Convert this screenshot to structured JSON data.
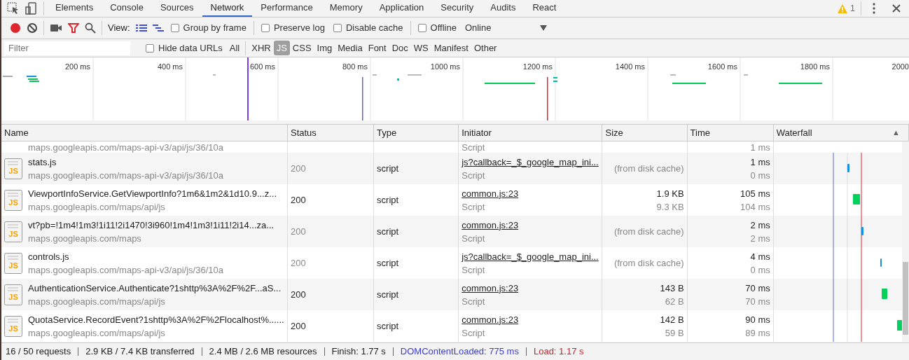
{
  "tabs": [
    {
      "label": "Elements",
      "selected": false
    },
    {
      "label": "Console",
      "selected": false
    },
    {
      "label": "Sources",
      "selected": false
    },
    {
      "label": "Network",
      "selected": true
    },
    {
      "label": "Performance",
      "selected": false
    },
    {
      "label": "Memory",
      "selected": false
    },
    {
      "label": "Application",
      "selected": false
    },
    {
      "label": "Security",
      "selected": false
    },
    {
      "label": "Audits",
      "selected": false
    },
    {
      "label": "React",
      "selected": false
    }
  ],
  "warnings": {
    "count": "1"
  },
  "toolbar": {
    "recording": true,
    "filter_active": true,
    "view_label": "View:",
    "checkboxes": [
      {
        "label": "Group by frame",
        "checked": false
      },
      {
        "label": "Preserve log",
        "checked": false
      },
      {
        "label": "Disable cache",
        "checked": false
      },
      {
        "label": "Offline",
        "checked": false
      }
    ],
    "throttling": "Online"
  },
  "filter_bar": {
    "placeholder": "Filter",
    "hide_data_urls": {
      "label": "Hide data URLs",
      "checked": false
    },
    "types": [
      {
        "label": "All",
        "selected": false
      },
      {
        "label": "XHR",
        "selected": false
      },
      {
        "label": "JS",
        "selected": true
      },
      {
        "label": "CSS",
        "selected": false
      },
      {
        "label": "Img",
        "selected": false
      },
      {
        "label": "Media",
        "selected": false
      },
      {
        "label": "Font",
        "selected": false
      },
      {
        "label": "Doc",
        "selected": false
      },
      {
        "label": "WS",
        "selected": false
      },
      {
        "label": "Manifest",
        "selected": false
      },
      {
        "label": "Other",
        "selected": false
      }
    ]
  },
  "overview": {
    "ticks": [
      "200 ms",
      "400 ms",
      "600 ms",
      "800 ms",
      "1000 ms",
      "1200 ms",
      "1400 ms",
      "1600 ms",
      "1800 ms",
      "2000"
    ]
  },
  "table": {
    "columns": [
      "Name",
      "Status",
      "Type",
      "Initiator",
      "Size",
      "Time",
      "Waterfall"
    ],
    "sort_indicator": "▲",
    "partial_row": {
      "url": "maps.googleapis.com/maps-api-v3/api/js/36/10a",
      "initiator_type": "Script",
      "latency": "1 ms"
    },
    "rows": [
      {
        "icon_label": "JS",
        "name": "stats.js",
        "url": "maps.googleapis.com/maps-api-v3/api/js/36/10a",
        "status": "200",
        "from_cache": true,
        "type": "script",
        "initiator": "js?callback=_$_google_map_ini...",
        "initiator_type": "Script",
        "size": "(from disk cache)",
        "time": "1 ms",
        "latency": "0 ms"
      },
      {
        "icon_label": "JS",
        "name": "ViewportInfoService.GetViewportInfo?1m6&1m2&1d10.9...z...",
        "url": "maps.googleapis.com/maps/api/js",
        "status": "200",
        "from_cache": false,
        "type": "script",
        "initiator": "common.js:23",
        "initiator_type": "Script",
        "size": "1.9 KB",
        "resource_size": "9.3 KB",
        "time": "105 ms",
        "latency": "104 ms"
      },
      {
        "icon_label": "JS",
        "name": "vt?pb=!1m4!1m3!1i11!2i1470!3i960!1m4!1m3!1i11!2i14...za...",
        "url": "maps.googleapis.com/maps",
        "status": "200",
        "from_cache": true,
        "type": "script",
        "initiator": "common.js:23",
        "initiator_type": "Script",
        "size": "(from disk cache)",
        "time": "2 ms",
        "latency": "2 ms"
      },
      {
        "icon_label": "JS",
        "name": "controls.js",
        "url": "maps.googleapis.com/maps-api-v3/api/js/36/10a",
        "status": "200",
        "from_cache": true,
        "type": "script",
        "initiator": "js?callback=_$_google_map_ini...",
        "initiator_type": "Script",
        "size": "(from disk cache)",
        "time": "4 ms",
        "latency": "0 ms"
      },
      {
        "icon_label": "JS",
        "name": "AuthenticationService.Authenticate?1shttp%3A%2F%2F...aS...",
        "url": "maps.googleapis.com/maps/api/js",
        "status": "200",
        "from_cache": false,
        "type": "script",
        "initiator": "common.js:23",
        "initiator_type": "Script",
        "size": "143 B",
        "resource_size": "62 B",
        "time": "70 ms",
        "latency": "70 ms"
      },
      {
        "icon_label": "JS",
        "name": "QuotaService.RecordEvent?1shttp%3A%2F%2Flocalhost%......",
        "url": "maps.googleapis.com/maps/api/js",
        "status": "200",
        "from_cache": false,
        "type": "script",
        "initiator": "common.js:23",
        "initiator_type": "Script",
        "size": "142 B",
        "resource_size": "59 B",
        "time": "90 ms",
        "latency": "89 ms"
      }
    ]
  },
  "status_bar": [
    {
      "kind": "plain",
      "text": "16 / 50 requests"
    },
    {
      "kind": "plain",
      "text": "2.9 KB / 7.4 KB transferred"
    },
    {
      "kind": "plain",
      "text": "2.4 MB / 2.6 MB resources"
    },
    {
      "kind": "plain",
      "text": "Finish: 1.77 s"
    },
    {
      "kind": "dom",
      "text": "DOMContentLoaded: 775 ms"
    },
    {
      "kind": "load",
      "text": "Load: 1.17 s"
    }
  ]
}
